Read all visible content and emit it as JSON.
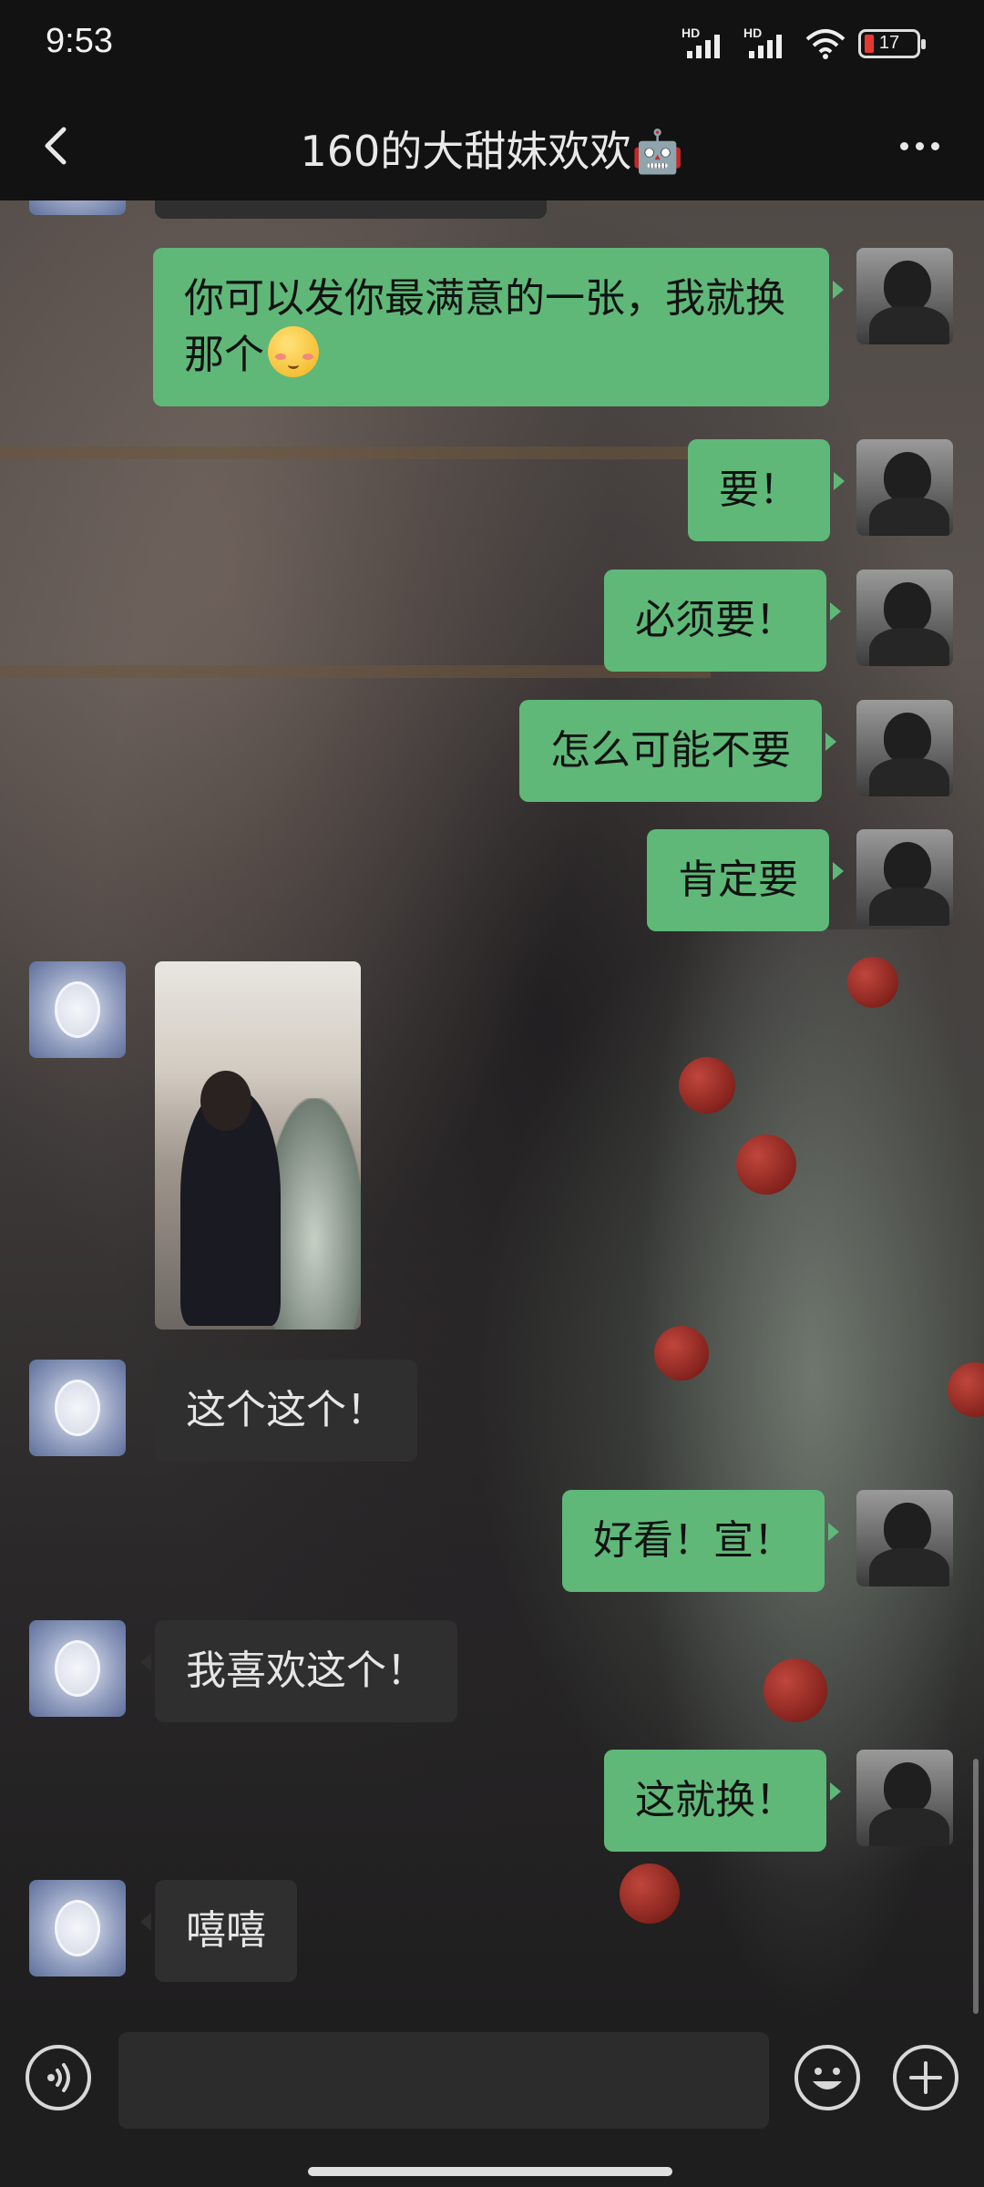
{
  "status": {
    "time": "9:53",
    "battery": "17",
    "network": "HD"
  },
  "header": {
    "title": "160的大甜妹欢欢🤖"
  },
  "messages": [
    {
      "from": "me",
      "text": "你可以发你最满意的一张，我就换那个",
      "emoji": "smiling-face-with-blush"
    },
    {
      "from": "me",
      "text": "要！"
    },
    {
      "from": "me",
      "text": "必须要！"
    },
    {
      "from": "me",
      "text": "怎么可能不要"
    },
    {
      "from": "me",
      "text": "肯定要"
    },
    {
      "from": "her",
      "type": "image"
    },
    {
      "from": "her",
      "text": "这个这个！"
    },
    {
      "from": "me",
      "text": "好看！宣！"
    },
    {
      "from": "her",
      "text": "我喜欢这个！"
    },
    {
      "from": "me",
      "text": "这就换！"
    },
    {
      "from": "her",
      "text": "嘻嘻"
    }
  ],
  "input": {
    "value": ""
  },
  "icons": {
    "back": "chevron-left-icon",
    "more": "more-icon",
    "voice": "voice-icon",
    "emoji": "emoji-icon",
    "plus": "plus-icon"
  },
  "colors": {
    "my_bubble": "#5fb878",
    "her_bubble": "#2f2f2f",
    "bar": "#121212"
  }
}
